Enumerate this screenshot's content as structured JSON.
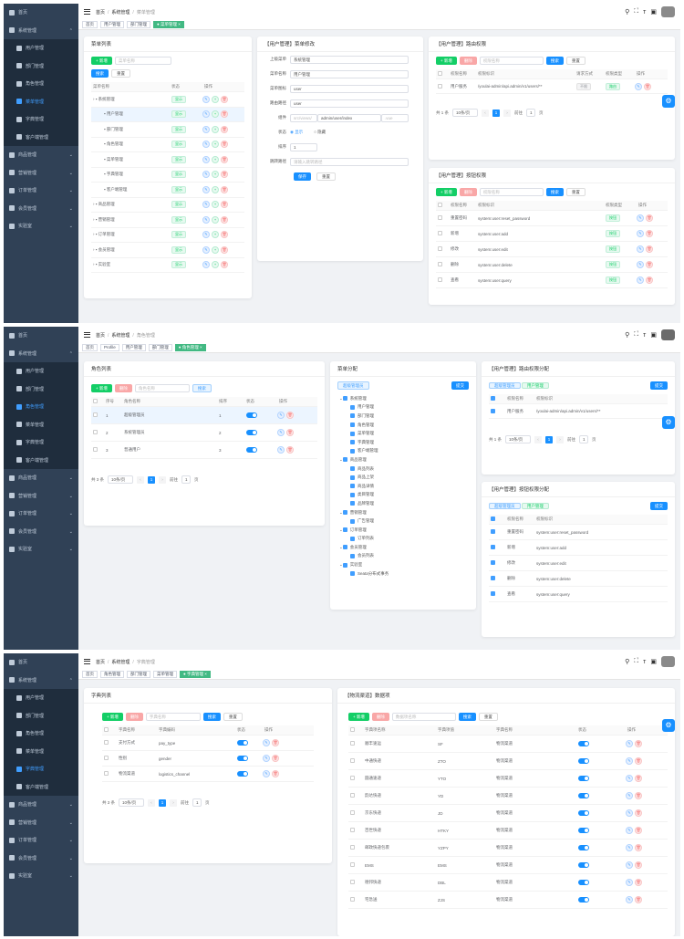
{
  "sidebar": {
    "home": "首页",
    "system": "系统管理",
    "user": "用户管理",
    "dept": "部门管理",
    "role": "角色管理",
    "menu": "菜单管理",
    "dict": "字典管理",
    "client": "客户端管理",
    "product": "商品管理",
    "marketing": "营销管理",
    "order": "订单管理",
    "member": "会员管理",
    "lab": "实验室"
  },
  "shot1": {
    "breadcrumb": [
      "首页",
      "系统管理",
      "菜单管理"
    ],
    "tags": [
      "首页",
      "用户管理",
      "部门管理",
      "● 菜单管理 ×"
    ],
    "menu_list": {
      "title": "菜单列表",
      "add": "+ 新增",
      "search_placeholder": "菜单名称",
      "search": "搜索",
      "reset": "重置",
      "headers": [
        "菜单名称",
        "状态",
        "操作"
      ],
      "status": "显示",
      "rows": [
        "系统管理",
        "用户管理",
        "部门管理",
        "角色管理",
        "菜单管理",
        "字典管理",
        "客户端管理",
        "商品管理",
        "营销管理",
        "订单管理",
        "会员管理",
        "实验室"
      ]
    },
    "form": {
      "title": "【用户管理】菜单修改",
      "parent_label": "上级菜单",
      "parent": "系统管理",
      "name_label": "菜单名称",
      "name": "用户管理",
      "icon_label": "菜单图标",
      "icon": "user",
      "path_label": "路由路径",
      "path": "user",
      "comp_label": "组件",
      "comp_prefix": "src/views/",
      "comp": "admin/user/index",
      "comp_suffix": ".vue",
      "status_label": "状态",
      "show": "显示",
      "hide": "隐藏",
      "sort_label": "排序",
      "sort": "1",
      "redirect_label": "跳转路径",
      "redirect_ph": "请输入跳转路径",
      "save": "保存",
      "reset": "重置"
    },
    "route_perm": {
      "title": "【用户管理】路由权限",
      "add": "+ 新增",
      "del": "删除",
      "ph": "权限名称",
      "search": "搜索",
      "reset": "重置",
      "headers": [
        "权限名称",
        "权限标识",
        "请求方式",
        "权限类型",
        "操作"
      ],
      "row": {
        "name": "用户服务",
        "url": "/youlai-admin/api.admin/v1/users/**",
        "method": "不限",
        "type": "路由"
      },
      "total": "共 1 条",
      "per": "10条/页",
      "page": "1",
      "goto": "前往",
      "goto_page": "1",
      "unit": "页"
    },
    "btn_perm": {
      "title": "【用户管理】按钮权限",
      "add": "+ 新增",
      "del": "删除",
      "ph": "权限名称",
      "search": "搜索",
      "reset": "重置",
      "headers": [
        "权限名称",
        "权限标识",
        "权限类型",
        "操作"
      ],
      "rows": [
        [
          "重置密码",
          "system:user:reset_password"
        ],
        [
          "新增",
          "system:user:add"
        ],
        [
          "修改",
          "system:user:edit"
        ],
        [
          "删除",
          "system:user:delete"
        ],
        [
          "查看",
          "system:user:query"
        ]
      ],
      "type": "按钮"
    }
  },
  "shot2": {
    "breadcrumb": [
      "首页",
      "系统管理",
      "角色管理"
    ],
    "tags": [
      "首页",
      "Profile",
      "用户管理",
      "部门管理",
      "● 角色管理 ×"
    ],
    "role_list": {
      "title": "角色列表",
      "add": "+ 新增",
      "del": "删除",
      "ph": "角色名称",
      "search": "搜索",
      "headers": [
        "序号",
        "角色名称",
        "排序",
        "状态",
        "操作"
      ],
      "rows": [
        [
          "1",
          "超级管理员",
          "1"
        ],
        [
          "2",
          "系统管理员",
          "2"
        ],
        [
          "3",
          "普通用户",
          "3"
        ]
      ],
      "total": "共 3 条",
      "per": "10条/页",
      "page": "1",
      "goto": "前往",
      "goto_page": "1",
      "unit": "页"
    },
    "menu_assign": {
      "title": "菜单分配",
      "role_tag": "超级管理员",
      "submit": "提交",
      "tree": [
        [
          0,
          "系统管理"
        ],
        [
          1,
          "用户管理"
        ],
        [
          1,
          "部门管理"
        ],
        [
          1,
          "角色管理"
        ],
        [
          1,
          "菜单管理"
        ],
        [
          1,
          "字典管理"
        ],
        [
          1,
          "客户端管理"
        ],
        [
          0,
          "商品管理"
        ],
        [
          1,
          "商品列表"
        ],
        [
          1,
          "商品上架"
        ],
        [
          1,
          "商品详情"
        ],
        [
          1,
          "类目管理"
        ],
        [
          1,
          "品牌管理"
        ],
        [
          0,
          "营销管理"
        ],
        [
          1,
          "广告管理"
        ],
        [
          0,
          "订单管理"
        ],
        [
          1,
          "订单列表"
        ],
        [
          0,
          "会员管理"
        ],
        [
          1,
          "会员列表"
        ],
        [
          0,
          "实验室"
        ],
        [
          1,
          "Seata分布式事务"
        ]
      ]
    },
    "route_assign": {
      "title": "【用户管理】路由权限分配",
      "tag1": "超级管理员",
      "tag2": "用户管理",
      "submit": "提交",
      "headers": [
        "权限名称",
        "权限标识"
      ],
      "row": [
        "用户服务",
        "/youlai-admin/api.admin/v1/users/**"
      ],
      "total": "共 1 条",
      "per": "10条/页",
      "page": "1",
      "goto": "前往",
      "goto_page": "1",
      "unit": "页"
    },
    "btn_assign": {
      "title": "【用户管理】按钮权限分配",
      "tag1": "超级管理员",
      "tag2": "用户管理",
      "submit": "提交",
      "headers": [
        "权限名称",
        "权限标识"
      ],
      "rows": [
        [
          "重置密码",
          "system:user:reset_password"
        ],
        [
          "新增",
          "system:user:add"
        ],
        [
          "修改",
          "system:user:edit"
        ],
        [
          "删除",
          "system:user:delete"
        ],
        [
          "查看",
          "system:user:query"
        ]
      ]
    }
  },
  "shot3": {
    "breadcrumb": [
      "首页",
      "系统管理",
      "字典管理"
    ],
    "tags": [
      "首页",
      "角色管理",
      "部门管理",
      "菜单管理",
      "● 字典管理 ×"
    ],
    "dict_list": {
      "title": "字典列表",
      "add": "+ 新增",
      "del": "删除",
      "ph": "字典名称",
      "search": "搜索",
      "reset": "重置",
      "headers": [
        "字典名称",
        "字典编码",
        "状态",
        "操作"
      ],
      "rows": [
        [
          "支付方式",
          "pay_type"
        ],
        [
          "性别",
          "gender"
        ],
        [
          "物流渠道",
          "logistics_channel"
        ]
      ],
      "total": "共 3 条",
      "per": "10条/页",
      "page": "1",
      "goto": "前往",
      "goto_page": "1",
      "unit": "页"
    },
    "dict_data": {
      "title": "【物流渠道】数据项",
      "add": "+ 新增",
      "del": "删除",
      "ph": "数据项名称",
      "search": "搜索",
      "reset": "重置",
      "headers": [
        "字典项名称",
        "字典项值",
        "字典名称",
        "状态",
        "操作"
      ],
      "rows": [
        [
          "顺丰速运",
          "SF"
        ],
        [
          "中通快递",
          "ZTO"
        ],
        [
          "圆通速递",
          "YTO"
        ],
        [
          "韵达快递",
          "YD"
        ],
        [
          "京东快递",
          "JD"
        ],
        [
          "百世快递",
          "HTKY"
        ],
        [
          "邮政快递包裹",
          "YZPY"
        ],
        [
          "EMS",
          "EMS"
        ],
        [
          "德邦快递",
          "DBL"
        ],
        [
          "宅急送",
          "ZJS"
        ]
      ],
      "dict": "物流渠道"
    }
  }
}
